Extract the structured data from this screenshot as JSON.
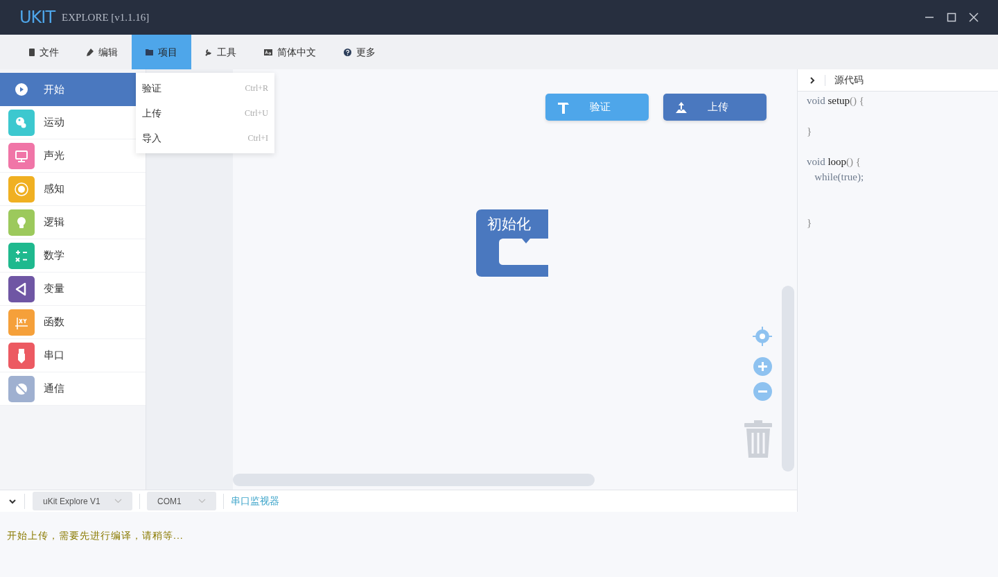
{
  "window": {
    "logo": "UKIT",
    "title": "EXPLORE [v1.1.16]"
  },
  "menu": [
    {
      "label": "文件",
      "selected": false
    },
    {
      "label": "编辑",
      "selected": false
    },
    {
      "label": "项目",
      "selected": true
    },
    {
      "label": "工具",
      "selected": false
    },
    {
      "label": "简体中文",
      "selected": false
    },
    {
      "label": "更多",
      "selected": false
    }
  ],
  "dropdown": [
    {
      "label": "验证",
      "shortcut": "Ctrl+R"
    },
    {
      "label": "上传",
      "shortcut": "Ctrl+U"
    },
    {
      "label": "导入",
      "shortcut": "Ctrl+I"
    }
  ],
  "categories": [
    {
      "label": "开始",
      "selected": true,
      "color": "#4a78bf"
    },
    {
      "label": "运动",
      "selected": false,
      "color": "#3cc8cf"
    },
    {
      "label": "声光",
      "selected": false,
      "color": "#f075a7"
    },
    {
      "label": "感知",
      "selected": false,
      "color": "#f0b022"
    },
    {
      "label": "逻辑",
      "selected": false,
      "color": "#9cc95c"
    },
    {
      "label": "数学",
      "selected": false,
      "color": "#1fb98e"
    },
    {
      "label": "变量",
      "selected": false,
      "color": "#6f56a4"
    },
    {
      "label": "函数",
      "selected": false,
      "color": "#f5a03a"
    },
    {
      "label": "串口",
      "selected": false,
      "color": "#ec5a62"
    },
    {
      "label": "通信",
      "selected": false,
      "color": "#9fb0d0"
    }
  ],
  "canvas": {
    "buttons": [
      {
        "label": "验证",
        "kind": "verify"
      },
      {
        "label": "上传",
        "kind": "upload"
      }
    ],
    "block": {
      "label": "初始化"
    }
  },
  "code_panel": {
    "title": "源代码",
    "lines": [
      {
        "blank": false,
        "segments": [
          {
            "text": "void ",
            "kind": "keyword"
          },
          {
            "text": "setup",
            "kind": "name"
          },
          {
            "text": "() {",
            "kind": "punct"
          }
        ]
      },
      {
        "blank": true
      },
      {
        "blank": false,
        "segments": [
          {
            "text": "}",
            "kind": "punct"
          }
        ]
      },
      {
        "blank": true
      },
      {
        "blank": false,
        "segments": [
          {
            "text": "void ",
            "kind": "keyword"
          },
          {
            "text": "loop",
            "kind": "name"
          },
          {
            "text": "() {",
            "kind": "punct"
          }
        ]
      },
      {
        "blank": false,
        "segments": [
          {
            "text": "   while(true);",
            "kind": "keyword"
          }
        ]
      },
      {
        "blank": true
      },
      {
        "blank": true
      },
      {
        "blank": false,
        "segments": [
          {
            "text": "}",
            "kind": "punct"
          }
        ]
      }
    ]
  },
  "bottom_bar": {
    "board": "uKit Explore V1",
    "port": "COM1",
    "monitor_link": "串口监视器"
  },
  "console": {
    "message": "开始上传，需要先进行编译，请稍等..."
  }
}
